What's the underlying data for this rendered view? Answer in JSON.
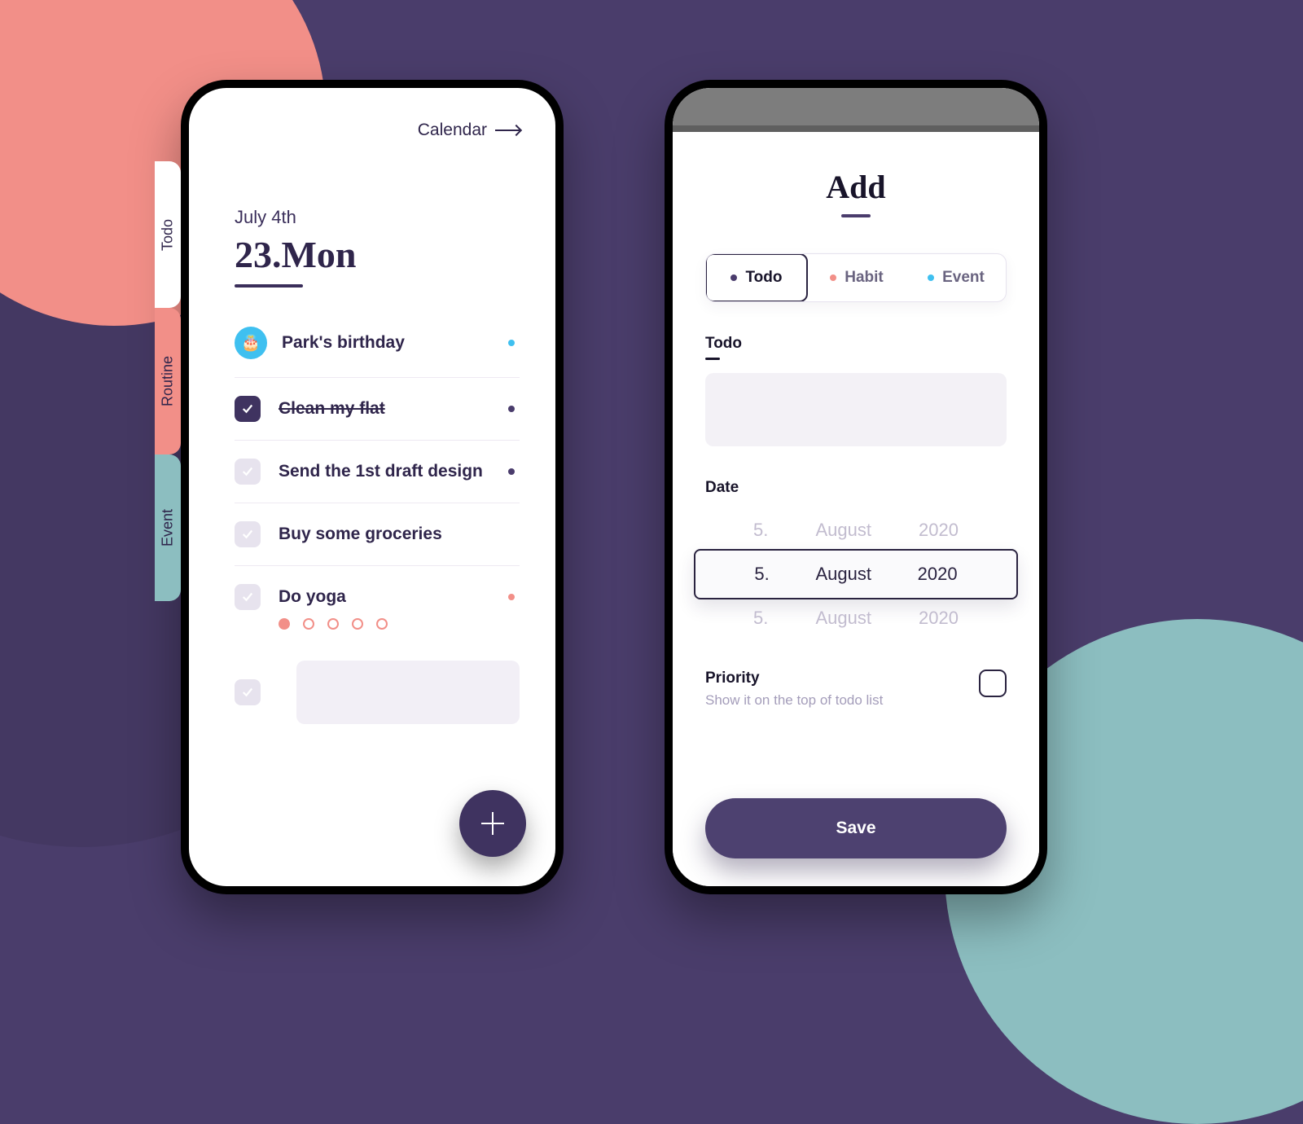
{
  "left": {
    "calendar_link": "Calendar",
    "date_small": "July 4th",
    "date_big": "23.Mon",
    "side_tabs": {
      "todo": "Todo",
      "routine": "Routine",
      "event": "Event"
    },
    "items": [
      {
        "text": "Park's birthday",
        "done": false,
        "type": "event",
        "dot": "teal"
      },
      {
        "text": "Clean my flat",
        "done": true,
        "type": "todo",
        "dot": "purple"
      },
      {
        "text": "Send the 1st draft design",
        "done": false,
        "type": "todo",
        "dot": "purple"
      },
      {
        "text": "Buy some groceries",
        "done": false,
        "type": "todo",
        "dot": ""
      },
      {
        "text": "Do yoga",
        "done": false,
        "type": "habit",
        "dot": "coral"
      }
    ],
    "streak_total": 5,
    "streak_done": 1
  },
  "right": {
    "title": "Add",
    "types": [
      {
        "label": "Todo",
        "color": "p",
        "selected": true
      },
      {
        "label": "Habit",
        "color": "c",
        "selected": false
      },
      {
        "label": "Event",
        "color": "t",
        "selected": false
      }
    ],
    "field_todo_label": "Todo",
    "field_date_label": "Date",
    "date_picker": {
      "prev": {
        "day": "5.",
        "month": "August",
        "year": "2020"
      },
      "sel": {
        "day": "5.",
        "month": "August",
        "year": "2020"
      },
      "next": {
        "day": "5.",
        "month": "August",
        "year": "2020"
      }
    },
    "priority_label": "Priority",
    "priority_sub": "Show it on the top of todo list",
    "save_label": "Save"
  }
}
